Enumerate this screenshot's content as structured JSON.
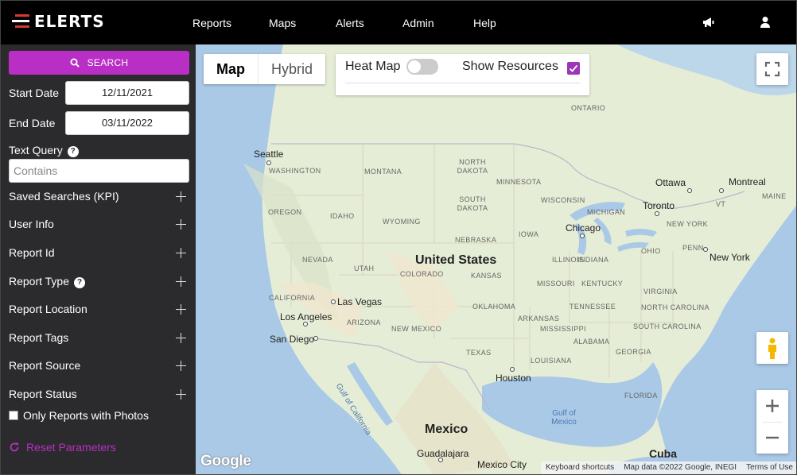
{
  "app": {
    "brand": "ELERTS"
  },
  "nav": {
    "items": [
      "Reports",
      "Maps",
      "Alerts",
      "Admin",
      "Help"
    ],
    "icons": [
      "megaphone-icon",
      "user-icon"
    ]
  },
  "sidebar": {
    "search_label": "SEARCH",
    "start_date_label": "Start Date",
    "start_date_value": "12/11/2021",
    "end_date_label": "End Date",
    "end_date_value": "03/11/2022",
    "text_query_label": "Text Query",
    "text_query_placeholder": "Contains",
    "sections": [
      "Saved Searches (KPI)",
      "User Info",
      "Report Id",
      "Report Type",
      "Report Location",
      "Report Tags",
      "Report Source",
      "Report Status"
    ],
    "only_photos_label": "Only Reports with Photos",
    "reset_label": "Reset Parameters",
    "accent_color": "#b92ec4"
  },
  "map": {
    "type_tabs": [
      "Map",
      "Hybrid"
    ],
    "active_type": "Map",
    "heatmap_label": "Heat Map",
    "heatmap_on": false,
    "show_resources_label": "Show Resources",
    "show_resources_checked": true,
    "google_label": "Google",
    "attribution": [
      "Keyboard shortcuts",
      "Map data ©2022 Google, INEGI",
      "Terms of Use"
    ],
    "labels": {
      "countries": [
        "United States",
        "Mexico",
        "Cuba"
      ],
      "cities": [
        "Seattle",
        "Ottawa",
        "Montreal",
        "Toronto",
        "Chicago",
        "New York",
        "Las Vegas",
        "Los Angeles",
        "San Diego",
        "Houston",
        "Guadalajara",
        "Mexico City"
      ],
      "states": [
        "WASHINGTON",
        "MONTANA",
        "NORTH DAKOTA",
        "MINNESOTA",
        "OREGON",
        "IDAHO",
        "SOUTH DAKOTA",
        "WISCONSIN",
        "MICHIGAN",
        "WYOMING",
        "IOWA",
        "NEBRASKA",
        "NEVADA",
        "UTAH",
        "COLORADO",
        "KANSAS",
        "ILLINOIS",
        "INDIANA",
        "OHIO",
        "PENN",
        "CALIFORNIA",
        "MISSOURI",
        "KENTUCKY",
        "VIRGINIA",
        "TENNESSEE",
        "OKLAHOMA",
        "ARIZONA",
        "NEW MEXICO",
        "ARKANSAS",
        "NORTH CAROLINA",
        "SOUTH CAROLINA",
        "MISSISSIPPI",
        "ALABAMA",
        "GEORGIA",
        "TEXAS",
        "LOUISIANA",
        "FLORIDA",
        "NEW YORK",
        "ONTARIO",
        "MAINE",
        "VT"
      ],
      "water": [
        "Gulf of California",
        "Gulf of Mexico"
      ]
    }
  }
}
